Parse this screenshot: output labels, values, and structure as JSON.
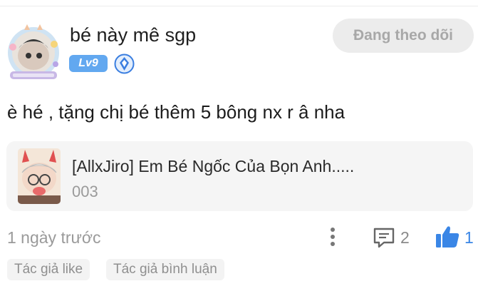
{
  "user": {
    "name": "bé này mê sgp",
    "level": "Lv9",
    "avatar_icon": "avatar-frame-with-sticker-icon",
    "badge_icon": "diamond-badge-icon"
  },
  "follow_button": {
    "label": "Đang theo dõi"
  },
  "comment": {
    "text": "è hé , tặng chị bé thêm 5 bông nx r â nha"
  },
  "story_card": {
    "title": "[AllxJiro] Em Bé Ngốc Của Bọn Anh.....",
    "chapter": "003",
    "thumbnail_icon": "manga-cover-thumbnail"
  },
  "footer": {
    "time": "1 ngày trước",
    "comment_count": "2",
    "like_count": "1"
  },
  "tags": [
    "Tác giả like",
    "Tác giả bình luận"
  ],
  "colors": {
    "accent": "#3a86e6",
    "level_badge": "#62a8f0",
    "button_bg": "#ececec"
  }
}
